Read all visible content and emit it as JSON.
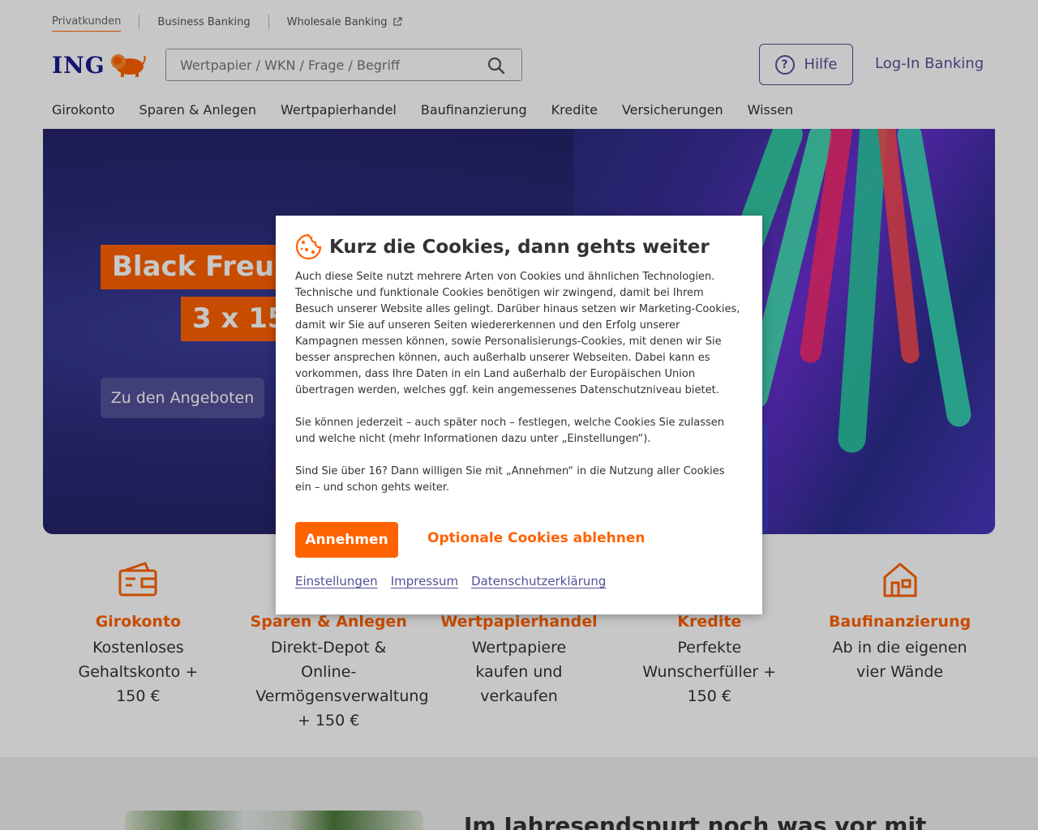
{
  "topnav": {
    "items": [
      "Privatkunden",
      "Business Banking",
      "Wholesale Banking"
    ]
  },
  "logo": {
    "text": "ING"
  },
  "search": {
    "placeholder": "Wertpapier / WKN / Frage / Begriff"
  },
  "header": {
    "help_label": "Hilfe",
    "login_label": "Log-In Banking"
  },
  "mainnav": {
    "items": [
      "Girokonto",
      "Sparen & Anlegen",
      "Wertpapierhandel",
      "Baufinanzierung",
      "Kredite",
      "Versicherungen",
      "Wissen"
    ]
  },
  "hero": {
    "title_line1": "Black Freu-D",
    "title_line2": "3 x 150",
    "cta_label": "Zu den Angeboten"
  },
  "features": [
    {
      "title": "Girokonto",
      "desc": "Kostenloses Gehaltskonto + 150 €",
      "icon": "wallet-icon"
    },
    {
      "title": "Sparen & Anlegen",
      "desc": "Direkt-Depot & Online-Vermögensverwaltung + 150 €",
      "icon": "piggy-icon"
    },
    {
      "title": "Wertpapierhandel",
      "desc": "Wertpapiere kaufen und verkaufen",
      "icon": "chart-icon"
    },
    {
      "title": "Kredite",
      "desc": "Perfekte Wunscherfüller + 150 €",
      "icon": "credit-icon"
    },
    {
      "title": "Baufinanzierung",
      "desc": "Ab in die eigenen vier Wände",
      "icon": "house-icon"
    }
  ],
  "teaser": {
    "title": "Im Jahresendspurt noch was vor mit"
  },
  "cookie_modal": {
    "title": "Kurz die Cookies, dann gehts weiter",
    "paragraph1": "Auch diese Seite nutzt mehrere Arten von Cookies und ähnlichen Technologien. Technische und funktionale Cookies benötigen wir zwingend, damit bei Ihrem Besuch unserer Website alles gelingt. Darüber hinaus setzen wir Marketing-Cookies, damit wir Sie auf unseren Seiten wiedererkennen und den Erfolg unserer Kampagnen messen können, sowie Personalisierungs-Cookies, mit denen wir Sie besser ansprechen können, auch außerhalb unserer Webseiten. Dabei kann es vorkommen, dass Ihre Daten in ein Land außerhalb der Europäischen Union übertragen werden, welches ggf. kein angemessenes Datenschutzniveau bietet.",
    "paragraph2": "Sie können jederzeit – auch später noch – festlegen, welche Cookies Sie zulassen und welche nicht (mehr Informationen dazu unter „Einstellungen“).",
    "paragraph3": "Sind Sie über 16? Dann willigen Sie mit „Annehmen“ in die Nutzung aller Cookies ein – und schon gehts weiter.",
    "accept_label": "Annehmen",
    "reject_label": "Optionale Cookies ablehnen",
    "links": [
      "Einstellungen",
      "Impressum",
      "Datenschutzerklärung"
    ]
  },
  "colors": {
    "brand_orange": "#ff6200",
    "brand_indigo": "#525199",
    "logo_blue": "#1a1b8f"
  }
}
